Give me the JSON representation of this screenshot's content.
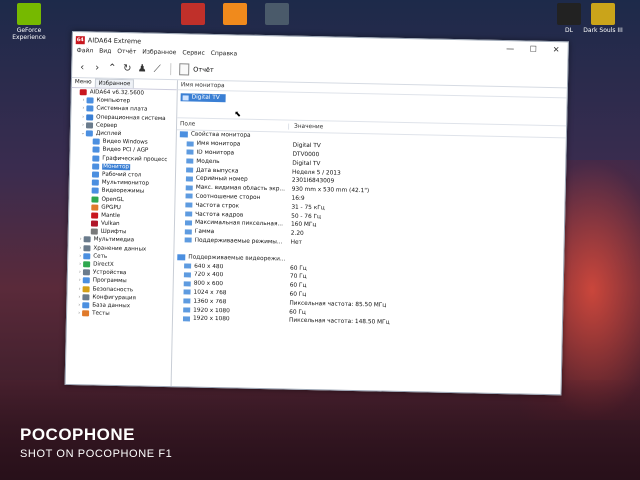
{
  "desktop": {
    "icons": [
      {
        "label": "GeForce Experience",
        "color": "#76b900"
      },
      {
        "label": "",
        "color": "#c0302a"
      },
      {
        "label": "",
        "color": "#f08a1c"
      },
      {
        "label": "",
        "color": "#4a5a6a"
      },
      {
        "label": "DL",
        "color": "#222222"
      },
      {
        "label": "Dark Souls III",
        "color": "#caa41a"
      }
    ]
  },
  "watermark": {
    "brand": "POCOPHONE",
    "shot": "SHOT ON POCOPHONE F1"
  },
  "window": {
    "title": "AIDA64 Extreme",
    "logo": "64",
    "controls": {
      "min": "—",
      "max": "☐",
      "close": "✕"
    },
    "menu": [
      "Файл",
      "Вид",
      "Отчёт",
      "Избранное",
      "Сервис",
      "Справка"
    ],
    "toolbar": {
      "report": "Отчёт"
    }
  },
  "sidebar": {
    "tabs": [
      "Меню",
      "Избранное"
    ],
    "items": [
      {
        "label": "AIDA64 v6.32.5600",
        "tw": "",
        "indent": 0,
        "color": "#c8161e",
        "selected": false
      },
      {
        "label": "Компьютер",
        "tw": "›",
        "indent": 1,
        "color": "#4b8fe0",
        "selected": false
      },
      {
        "label": "Системная плата",
        "tw": "›",
        "indent": 1,
        "color": "#4b8fe0",
        "selected": false
      },
      {
        "label": "Операционная система",
        "tw": "›",
        "indent": 1,
        "color": "#3a7fd4",
        "selected": false
      },
      {
        "label": "Сервер",
        "tw": "›",
        "indent": 1,
        "color": "#6a7b8c",
        "selected": false
      },
      {
        "label": "Дисплей",
        "tw": "⌄",
        "indent": 1,
        "color": "#4b8fe0",
        "selected": false
      },
      {
        "label": "Видео Windows",
        "tw": "",
        "indent": 2,
        "color": "#4b8fe0",
        "selected": false
      },
      {
        "label": "Видео PCI / AGP",
        "tw": "",
        "indent": 2,
        "color": "#4b8fe0",
        "selected": false
      },
      {
        "label": "Графический процесс",
        "tw": "",
        "indent": 2,
        "color": "#4b8fe0",
        "selected": false
      },
      {
        "label": "Монитор",
        "tw": "",
        "indent": 2,
        "color": "#4b8fe0",
        "selected": true
      },
      {
        "label": "Рабочий стол",
        "tw": "",
        "indent": 2,
        "color": "#4b8fe0",
        "selected": false
      },
      {
        "label": "Мультимонитор",
        "tw": "",
        "indent": 2,
        "color": "#4b8fe0",
        "selected": false
      },
      {
        "label": "Видеорежимы",
        "tw": "",
        "indent": 2,
        "color": "#4b8fe0",
        "selected": false
      },
      {
        "label": "OpenGL",
        "tw": "",
        "indent": 2,
        "color": "#2fa84f",
        "selected": false
      },
      {
        "label": "GPGPU",
        "tw": "",
        "indent": 2,
        "color": "#e07a2a",
        "selected": false
      },
      {
        "label": "Mantle",
        "tw": "",
        "indent": 2,
        "color": "#c8161e",
        "selected": false
      },
      {
        "label": "Vulkan",
        "tw": "",
        "indent": 2,
        "color": "#b0162a",
        "selected": false
      },
      {
        "label": "Шрифты",
        "tw": "",
        "indent": 2,
        "color": "#7a7a7a",
        "selected": false
      },
      {
        "label": "Мультимедиа",
        "tw": "›",
        "indent": 1,
        "color": "#6a7b8c",
        "selected": false
      },
      {
        "label": "Хранение данных",
        "tw": "›",
        "indent": 1,
        "color": "#6a7b8c",
        "selected": false
      },
      {
        "label": "Сеть",
        "tw": "›",
        "indent": 1,
        "color": "#4b8fe0",
        "selected": false
      },
      {
        "label": "DirectX",
        "tw": "›",
        "indent": 1,
        "color": "#2fa84f",
        "selected": false
      },
      {
        "label": "Устройства",
        "tw": "›",
        "indent": 1,
        "color": "#6a7b8c",
        "selected": false
      },
      {
        "label": "Программы",
        "tw": "›",
        "indent": 1,
        "color": "#4b8fe0",
        "selected": false
      },
      {
        "label": "Безопасность",
        "tw": "›",
        "indent": 1,
        "color": "#d4a017",
        "selected": false
      },
      {
        "label": "Конфигурация",
        "tw": "›",
        "indent": 1,
        "color": "#6a7b8c",
        "selected": false
      },
      {
        "label": "База данных",
        "tw": "›",
        "indent": 1,
        "color": "#4b8fe0",
        "selected": false
      },
      {
        "label": "Тесты",
        "tw": "›",
        "indent": 1,
        "color": "#e07a2a",
        "selected": false
      }
    ]
  },
  "monitor": {
    "header": "Имя монитора",
    "selected": "Digital TV",
    "columns": {
      "field": "Поле",
      "value": "Значение"
    },
    "section1": "Свойства монитора",
    "props": [
      {
        "field": "Имя монитора",
        "value": "Digital TV"
      },
      {
        "field": "ID монитора",
        "value": "DTV0000"
      },
      {
        "field": "Модель",
        "value": "Digital TV"
      },
      {
        "field": "Дата выпуска",
        "value": "Неделя 5 / 2013"
      },
      {
        "field": "Серийный номер",
        "value": "2301I6843009"
      },
      {
        "field": "Макс. видимая область экр...",
        "value": "930 mm x 530 mm (42.1\")"
      },
      {
        "field": "Соотношение сторон",
        "value": "16:9"
      },
      {
        "field": "Частота строк",
        "value": "31 - 75 кГц"
      },
      {
        "field": "Частота кадров",
        "value": "50 - 76 Гц"
      },
      {
        "field": "Максимальная пиксельная...",
        "value": "160 МГц"
      },
      {
        "field": "Гамма",
        "value": "2.20"
      },
      {
        "field": "Поддерживаемые режимы...",
        "value": "Нет"
      }
    ],
    "section2": "Поддерживаемые видеорежи...",
    "modes": [
      {
        "field": "640 x 480",
        "value": "60 Гц"
      },
      {
        "field": "720 x 400",
        "value": "70 Гц"
      },
      {
        "field": "800 x 600",
        "value": "60 Гц"
      },
      {
        "field": "1024 x 768",
        "value": "60 Гц"
      },
      {
        "field": "1360 x 768",
        "value": "Пиксельная частота: 85.50 МГц"
      },
      {
        "field": "1920 x 1080",
        "value": "60 Гц"
      },
      {
        "field": "1920 x 1080",
        "value": "Пиксельная частота: 148.50 МГц"
      }
    ]
  }
}
